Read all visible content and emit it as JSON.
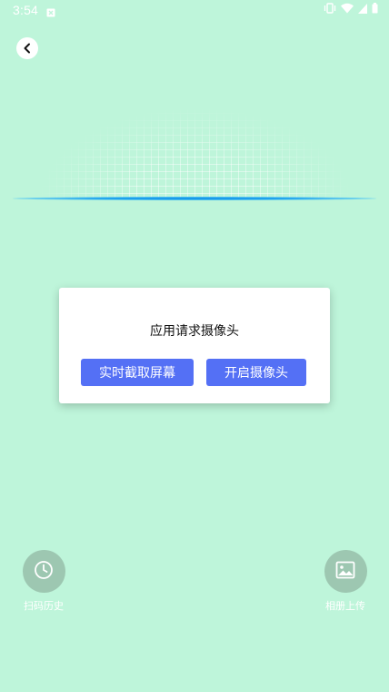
{
  "status_bar": {
    "time": "3:54"
  },
  "dialog": {
    "title": "应用请求摄像头",
    "buttons": {
      "screen_capture": "实时截取屏幕",
      "open_camera": "开启摄像头"
    }
  },
  "bottom_actions": {
    "history": {
      "label": "扫码历史",
      "icon": "clock-icon"
    },
    "album": {
      "label": "相册上传",
      "icon": "image-icon"
    }
  },
  "colors": {
    "background": "#bef5da",
    "primary_button": "#5470f5",
    "scan_line": "#1392e6",
    "action_circle": "#9dc7b1"
  }
}
